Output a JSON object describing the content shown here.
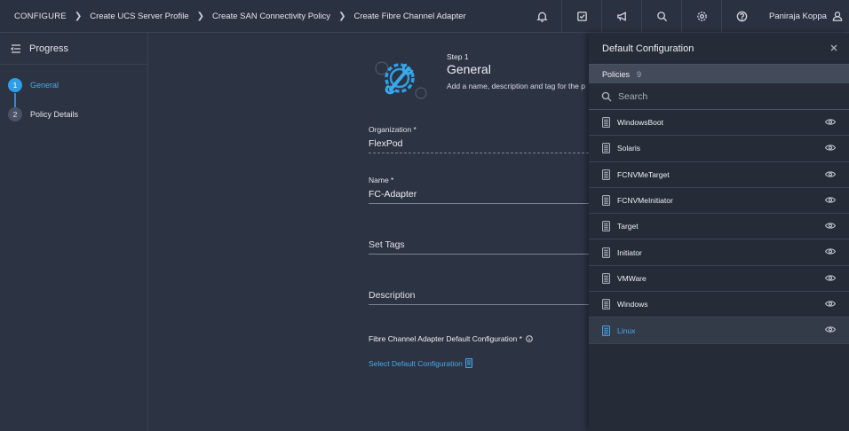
{
  "breadcrumb": {
    "items": [
      "CONFIGURE",
      "Create UCS Server Profile",
      "Create SAN Connectivity Policy",
      "Create Fibre Channel Adapter"
    ]
  },
  "header": {
    "icons": [
      "bell-icon",
      "task-check-icon",
      "megaphone-icon",
      "search-icon",
      "gear-icon",
      "help-icon"
    ],
    "user_name": "Paniraja Koppa"
  },
  "sidebar": {
    "title": "Progress",
    "steps": [
      {
        "number": "1",
        "label": "General",
        "active": true
      },
      {
        "number": "2",
        "label": "Policy Details",
        "active": false
      }
    ]
  },
  "form": {
    "step_label": "Step 1",
    "title": "General",
    "description": "Add a name, description and tag for the p",
    "organization": {
      "label": "Organization *",
      "value": "FlexPod"
    },
    "name": {
      "label": "Name *",
      "value": "FC-Adapter"
    },
    "tags": {
      "placeholder": "Set Tags"
    },
    "description_field": {
      "placeholder": "Description"
    },
    "default_config_label": "Fibre Channel Adapter Default Configuration *",
    "select_link": "Select Default Configuration"
  },
  "panel": {
    "title": "Default Configuration",
    "policies_label": "Policies",
    "policies_count": "9",
    "search_placeholder": "Search",
    "items": [
      "WindowsBoot",
      "Solaris",
      "FCNVMeTarget",
      "FCNVMeInitiator",
      "Target",
      "Initiator",
      "VMWare",
      "Windows",
      "Linux"
    ],
    "selected": "Linux"
  },
  "colors": {
    "accent": "#2e9fe6",
    "link": "#4aa8ea",
    "background": "#2c3342",
    "panel_background": "#252b37"
  }
}
